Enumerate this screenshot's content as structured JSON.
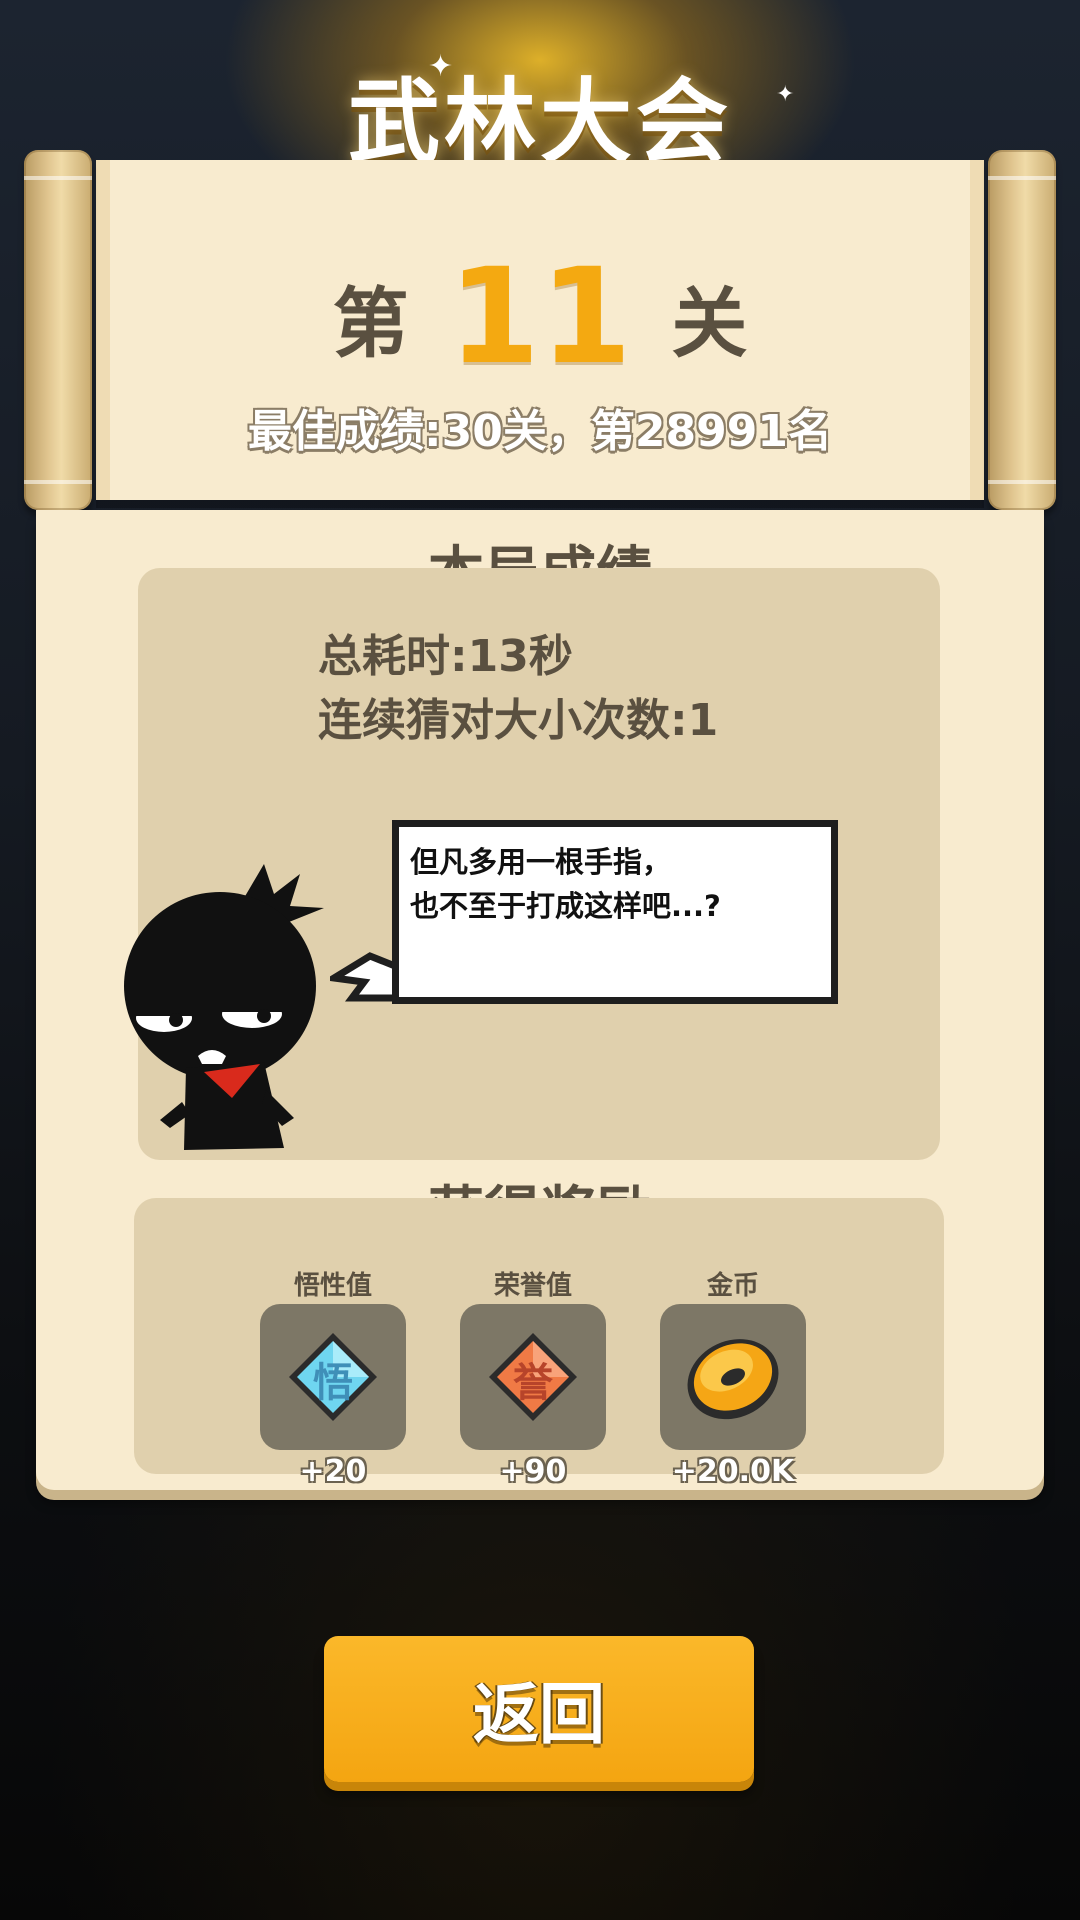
{
  "title": "武林大会",
  "level": {
    "prefix": "第",
    "number": "11",
    "suffix": "关"
  },
  "best_record": "最佳成绩:30关，第28991名",
  "round_results": {
    "title": "本局成绩",
    "total_time": "总耗时:13秒",
    "streak": "连续猜对大小次数:1"
  },
  "speech": {
    "line1": "但凡多用一根手指，",
    "line2": "也不至于打成这样吧...?"
  },
  "rewards": {
    "title": "获得奖励",
    "items": [
      {
        "label": "悟性值",
        "icon": "wisdom-diamond-icon",
        "glyph": "悟",
        "value": "+20",
        "color": "#6fd6f0"
      },
      {
        "label": "荣誉值",
        "icon": "honor-diamond-icon",
        "glyph": "誉",
        "value": "+90",
        "color": "#f07a45"
      },
      {
        "label": "金币",
        "icon": "gold-coin-icon",
        "value": "+20.0K",
        "color": "#f5a615"
      }
    ]
  },
  "back_button": "返回",
  "colors": {
    "accent_orange": "#f4a911",
    "parchment": "#f8ebcf",
    "text_brown": "#5a5040"
  }
}
